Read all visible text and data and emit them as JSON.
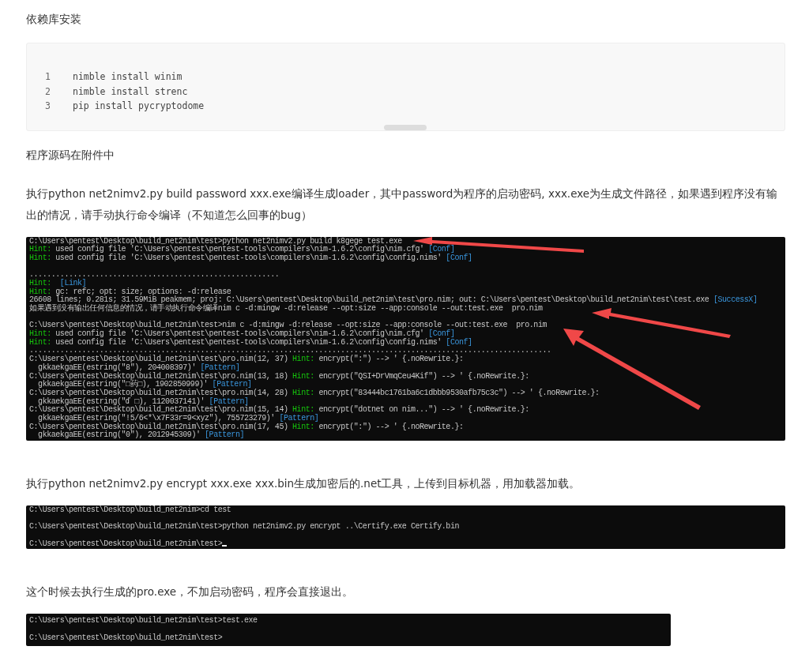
{
  "blocks": [
    {
      "kind": "paragraph",
      "text": "依赖库安装"
    },
    {
      "kind": "code",
      "lines": [
        {
          "number": "1",
          "text": "nimble install winim"
        },
        {
          "number": "2",
          "text": "nimble install strenc"
        },
        {
          "number": "3",
          "text": "pip install pycryptodome"
        }
      ]
    },
    {
      "kind": "paragraph",
      "text": "程序源码在附件中"
    },
    {
      "kind": "paragraph",
      "text": "执行python net2nimv2.py build password xxx.exe编译生成loader，其中password为程序的启动密码, xxx.exe为生成文件路径，如果遇到程序没有输出的情况，请手动执行命令编译（不知道怎么回事的bug）"
    },
    {
      "kind": "terminal",
      "annotated": true,
      "lines": [
        {
          "kind": "text",
          "parts": [
            {
              "kind": "plain",
              "text": "C:\\Users\\pentest\\Desktop\\build_net2nim\\test>python net2nimv2.py build k8gege test.exe"
            }
          ]
        },
        {
          "kind": "text",
          "parts": [
            {
              "kind": "hint",
              "text": "Hint:"
            },
            {
              "kind": "plain",
              "text": " used config file 'C:\\Users\\pentest\\pentest-tools\\compilers\\nim-1.6.2\\config\\nim.cfg' "
            },
            {
              "kind": "tag",
              "text": "[Conf]"
            }
          ]
        },
        {
          "kind": "text",
          "parts": [
            {
              "kind": "hint",
              "text": "Hint:"
            },
            {
              "kind": "plain",
              "text": " used config file 'C:\\Users\\pentest\\pentest-tools\\compilers\\nim-1.6.2\\config\\config.nims' "
            },
            {
              "kind": "tag",
              "text": "[Conf]"
            }
          ]
        },
        {
          "kind": "blank"
        },
        {
          "kind": "text",
          "parts": [
            {
              "kind": "plain",
              "text": "........................................................."
            }
          ]
        },
        {
          "kind": "text",
          "parts": [
            {
              "kind": "hint",
              "text": "Hint:"
            },
            {
              "kind": "tag",
              "text": "  [Link]"
            }
          ]
        },
        {
          "kind": "text",
          "parts": [
            {
              "kind": "hint",
              "text": "Hint:"
            },
            {
              "kind": "plain",
              "text": " gc: refc; opt: size; options: -d:release"
            }
          ]
        },
        {
          "kind": "text",
          "parts": [
            {
              "kind": "plain",
              "text": "26608 lines; 0.281s; 31.59MiB peakmem; proj: C:\\Users\\pentest\\Desktop\\build_net2nim\\test\\pro.nim; out: C:\\Users\\pentest\\Desktop\\build_net2nim\\test\\test.exe "
            },
            {
              "kind": "tag",
              "text": "[SuccessX]"
            }
          ]
        },
        {
          "kind": "text",
          "parts": [
            {
              "kind": "plain",
              "text": "如果遇到没有输出任何信息的情况，请手动执行命令编译nim c -d:mingw -d:release --opt:size --app:console --out:test.exe  pro.nim"
            }
          ]
        },
        {
          "kind": "blank"
        },
        {
          "kind": "text",
          "parts": [
            {
              "kind": "plain",
              "text": "C:\\Users\\pentest\\Desktop\\build_net2nim\\test>nim c -d:mingw -d:release --opt:size --app:console --out:test.exe  pro.nim"
            }
          ]
        },
        {
          "kind": "text",
          "parts": [
            {
              "kind": "hint",
              "text": "Hint:"
            },
            {
              "kind": "plain",
              "text": " used config file 'C:\\Users\\pentest\\pentest-tools\\compilers\\nim-1.6.2\\config\\nim.cfg' "
            },
            {
              "kind": "tag",
              "text": "[Conf]"
            }
          ]
        },
        {
          "kind": "text",
          "parts": [
            {
              "kind": "hint",
              "text": "Hint:"
            },
            {
              "kind": "plain",
              "text": " used config file 'C:\\Users\\pentest\\pentest-tools\\compilers\\nim-1.6.2\\config\\config.nims' "
            },
            {
              "kind": "tag",
              "text": "[Conf]"
            }
          ]
        },
        {
          "kind": "text",
          "parts": [
            {
              "kind": "plain",
              "text": "......................................................................................................................."
            }
          ]
        },
        {
          "kind": "text",
          "parts": [
            {
              "kind": "plain",
              "text": "C:\\Users\\pentest\\Desktop\\build_net2nim\\test\\pro.nim(12, 37) "
            },
            {
              "kind": "hint",
              "text": "Hint:"
            },
            {
              "kind": "plain",
              "text": " encrypt(\":\") --> ' {.noRewrite.}:"
            }
          ]
        },
        {
          "kind": "text",
          "parts": [
            {
              "kind": "plain",
              "text": "  gkkaekgaEE(estring(\"8\"), 204008397)' "
            },
            {
              "kind": "tag",
              "text": "[Pattern]"
            }
          ]
        },
        {
          "kind": "text",
          "parts": [
            {
              "kind": "plain",
              "text": "C:\\Users\\pentest\\Desktop\\build_net2nim\\test\\pro.nim(13, 18) "
            },
            {
              "kind": "hint",
              "text": "Hint:"
            },
            {
              "kind": "plain",
              "text": " encrypt(\"QSI+DrVmqCeu4Kif\") --> ' {.noRewrite.}:"
            }
          ]
        },
        {
          "kind": "text",
          "parts": [
            {
              "kind": "plain",
              "text": "  gkkaekgaEE(estring(\"□药□), 1902850999)' "
            },
            {
              "kind": "tag",
              "text": "[Pattern]"
            }
          ]
        },
        {
          "kind": "text",
          "parts": [
            {
              "kind": "plain",
              "text": "C:\\Users\\pentest\\Desktop\\build_net2nim\\test\\pro.nim(14, 28) "
            },
            {
              "kind": "hint",
              "text": "Hint:"
            },
            {
              "kind": "plain",
              "text": " encrypt(\"83444bc1761ba6c1dbbb9530afb75c3c\") --> ' {.noRewrite.}:"
            }
          ]
        },
        {
          "kind": "text",
          "parts": [
            {
              "kind": "plain",
              "text": "  gkkaekgaEE(estring(\"ď □), 1120037141)' "
            },
            {
              "kind": "tag",
              "text": "[Pattern]"
            }
          ]
        },
        {
          "kind": "text",
          "parts": [
            {
              "kind": "plain",
              "text": "C:\\Users\\pentest\\Desktop\\build_net2nim\\test\\pro.nim(15, 14) "
            },
            {
              "kind": "hint",
              "text": "Hint:"
            },
            {
              "kind": "plain",
              "text": " encrypt(\"dotnet on nim...\") --> ' {.noRewrite.}:"
            }
          ]
        },
        {
          "kind": "text",
          "parts": [
            {
              "kind": "plain",
              "text": "  gkkaekgaEE(estring(\"!5/6<*\\x7F33r=9<xyz\"), 755723279)' "
            },
            {
              "kind": "tag",
              "text": "[Pattern]"
            }
          ]
        },
        {
          "kind": "text",
          "parts": [
            {
              "kind": "plain",
              "text": "C:\\Users\\pentest\\Desktop\\build_net2nim\\test\\pro.nim(17, 45) "
            },
            {
              "kind": "hint",
              "text": "Hint:"
            },
            {
              "kind": "plain",
              "text": " encrypt(\":\") --> ' {.noRewrite.}:"
            }
          ]
        },
        {
          "kind": "text",
          "parts": [
            {
              "kind": "plain",
              "text": "  gkkaekgaEE(estring(\"0\"), 2012945309)' "
            },
            {
              "kind": "tag",
              "text": "[Pattern]"
            }
          ]
        }
      ]
    },
    {
      "kind": "paragraph",
      "text": "执行python net2nimv2.py encrypt xxx.exe xxx.bin生成加密后的.net工具，上传到目标机器，用加载器加载。"
    },
    {
      "kind": "terminal",
      "cursor": true,
      "lines": [
        {
          "kind": "text",
          "parts": [
            {
              "kind": "plain",
              "text": "C:\\Users\\pentest\\Desktop\\build_net2nim>cd test"
            }
          ]
        },
        {
          "kind": "blank"
        },
        {
          "kind": "text",
          "parts": [
            {
              "kind": "plain",
              "text": "C:\\Users\\pentest\\Desktop\\build_net2nim\\test>python net2nimv2.py encrypt ..\\Certify.exe Certify.bin"
            }
          ]
        },
        {
          "kind": "blank"
        },
        {
          "kind": "text",
          "parts": [
            {
              "kind": "plain",
              "text": "C:\\Users\\pentest\\Desktop\\build_net2nim\\test>"
            }
          ]
        }
      ]
    },
    {
      "kind": "paragraph",
      "text": "这个时候去执行生成的pro.exe，不加启动密码，程序会直接退出。"
    },
    {
      "kind": "terminal",
      "lines": [
        {
          "kind": "text",
          "parts": [
            {
              "kind": "plain",
              "text": "C:\\Users\\pentest\\Desktop\\build_net2nim\\test>test.exe"
            }
          ]
        },
        {
          "kind": "blank"
        },
        {
          "kind": "text",
          "parts": [
            {
              "kind": "plain",
              "text": "C:\\Users\\pentest\\Desktop\\build_net2nim\\test>"
            }
          ]
        }
      ]
    }
  ]
}
